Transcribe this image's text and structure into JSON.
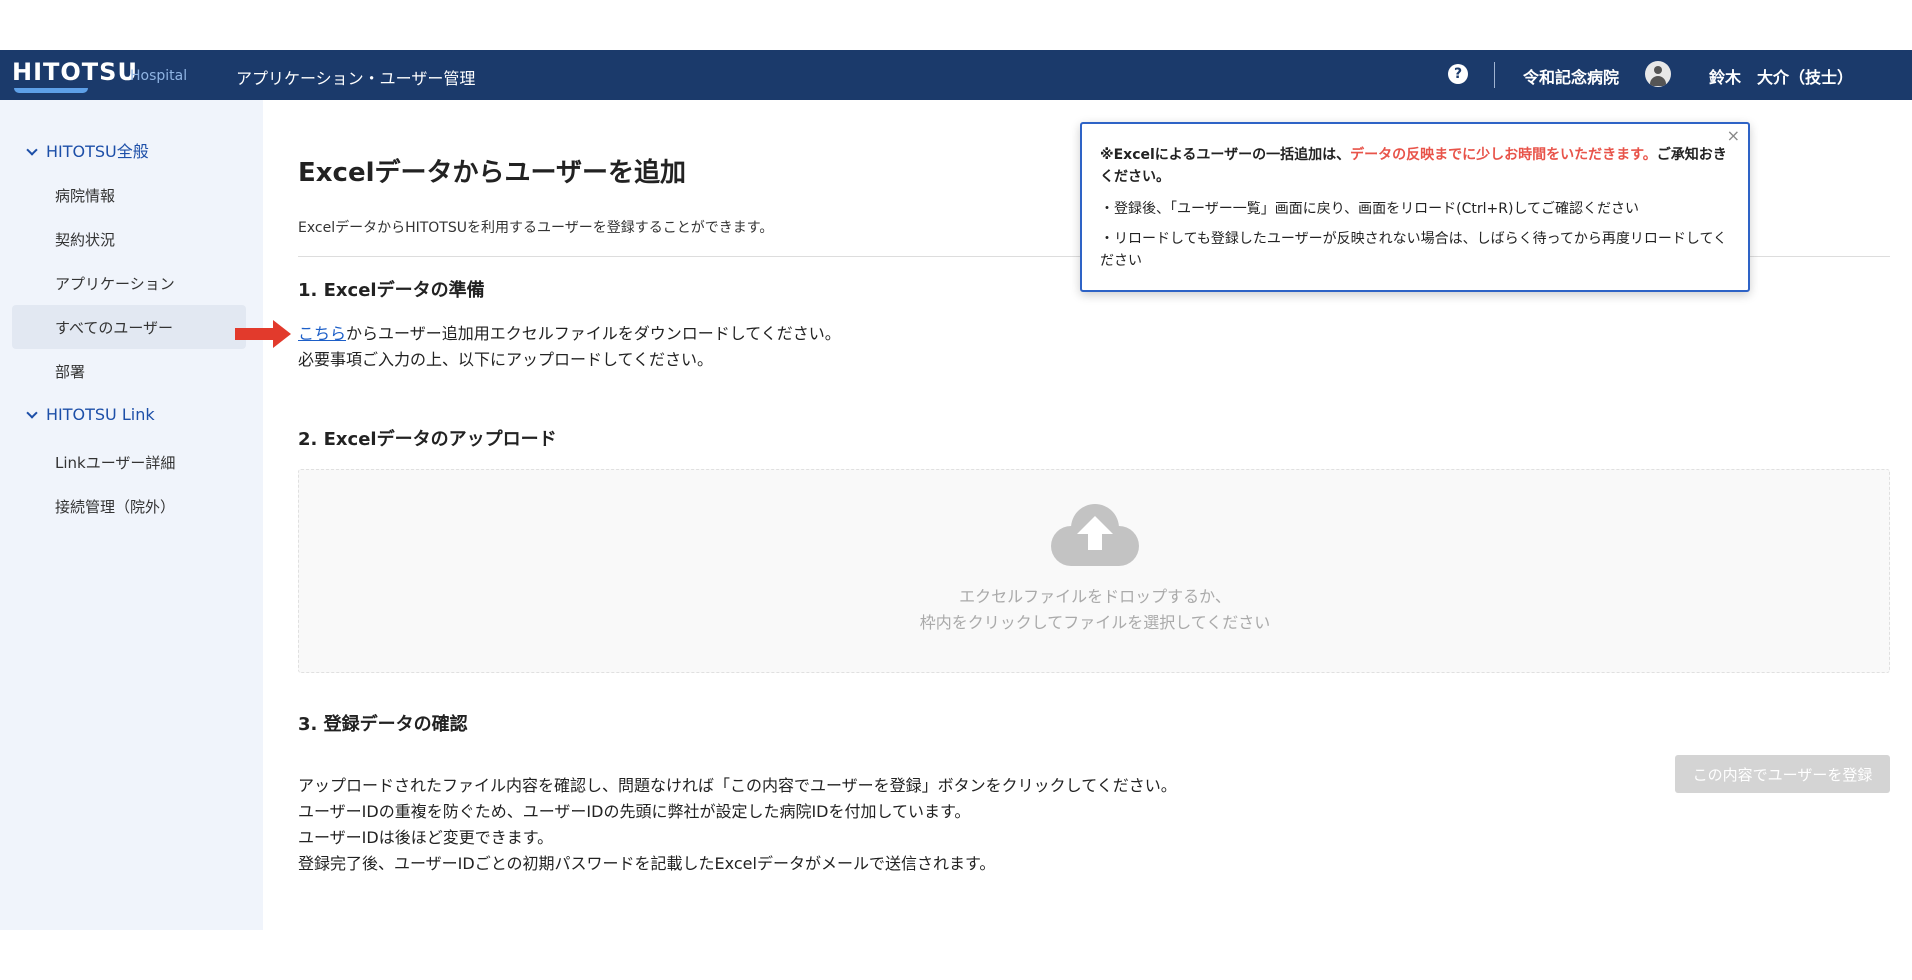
{
  "header": {
    "logo_main": "HITOTSU",
    "logo_sub": "Hospital",
    "title": "アプリケーション・ユーザー管理",
    "help_symbol": "?",
    "hospital": "令和記念病院",
    "user": "鈴木　大介（技士）"
  },
  "sidebar": {
    "section1": "HITOTSU全般",
    "items1": [
      "病院情報",
      "契約状況",
      "アプリケーション",
      "すべてのユーザー",
      "部署"
    ],
    "section2": "HITOTSU Link",
    "items2": [
      "Linkユーザー詳細",
      "接続管理（院外）"
    ]
  },
  "main": {
    "title": "Excelデータからユーザーを追加",
    "description": "ExcelデータからHITOTSUを利用するユーザーを登録することができます。",
    "step1": {
      "title": "1. Excelデータの準備",
      "link": "こちら",
      "line1_rest": "からユーザー追加用エクセルファイルをダウンロードしてください。",
      "line2": "必要事項ご入力の上、以下にアップロードしてください。"
    },
    "step2": {
      "title": "2. Excelデータのアップロード",
      "drop_line1": "エクセルファイルをドロップするか、",
      "drop_line2": "枠内をクリックしてファイルを選択してください"
    },
    "step3": {
      "title": "3. 登録データの確認",
      "lines": [
        "アップロードされたファイル内容を確認し、問題なければ「この内容でユーザーを登録」ボタンをクリックしてください。",
        "ユーザーIDの重複を防ぐため、ユーザーIDの先頭に弊社が設定した病院IDを付加しています。",
        "ユーザーIDは後ほど変更できます。",
        "登録完了後、ユーザーIDごとの初期パスワードを記載したExcelデータがメールで送信されます。"
      ],
      "button": "この内容でユーザーを登録"
    }
  },
  "toast": {
    "close": "×",
    "main_a": "※Excelによるユーザーの一括追加は、",
    "main_red": "データの反映までに少しお時間をいただきます。",
    "main_b": "ご承知おきください。",
    "line1": "・登録後、「ユーザー一覧」画面に戻り、画面をリロード(Ctrl+R)してご確認ください",
    "line2": "・リロードしても登録したユーザーが反映されない場合は、しばらく待ってから再度リロードしてください"
  },
  "colors": {
    "header_bg": "#1b3a6b",
    "sidebar_bg": "#f0f4fb",
    "accent": "#1d4fa8",
    "alert_red": "#e8544a",
    "arrow_red": "#e23a2c"
  }
}
